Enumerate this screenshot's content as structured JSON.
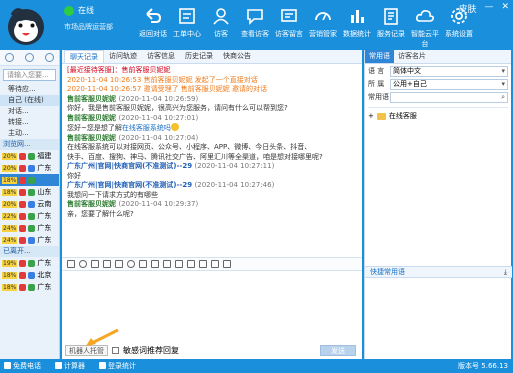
{
  "app": {
    "status": "在线",
    "org": "市场品牌运营部",
    "window_controls": [
      "皮肤",
      "—",
      "✕"
    ]
  },
  "toolbar": [
    {
      "label": "返回对话",
      "icon": "back-arrow-icon"
    },
    {
      "label": "工单中心",
      "icon": "ticket-icon"
    },
    {
      "label": "访客",
      "icon": "visitor-icon"
    },
    {
      "label": "查看访客",
      "icon": "chat-bubble-icon"
    },
    {
      "label": "访客留言",
      "icon": "message-board-icon"
    },
    {
      "label": "营销管家",
      "icon": "gauge-icon"
    },
    {
      "label": "数据统计",
      "icon": "bar-chart-icon"
    },
    {
      "label": "服务记录",
      "icon": "records-icon"
    },
    {
      "label": "智能云平台",
      "icon": "cloud-icon"
    },
    {
      "label": "系统设置",
      "icon": "gear-icon"
    }
  ],
  "left": {
    "search_placeholder": "请输入您要...",
    "groups": [
      {
        "label": "等待应...",
        "type": "row"
      },
      {
        "label": "自己 (在线)",
        "type": "sel"
      },
      {
        "label": "对话...",
        "type": "row"
      },
      {
        "label": "转接...",
        "type": "row"
      },
      {
        "label": "主动...",
        "type": "row"
      },
      {
        "label": "浏览网...",
        "type": "head"
      }
    ],
    "visitors": [
      {
        "pct": "20%",
        "name": "福建",
        "sel": false
      },
      {
        "pct": "20%",
        "name": "广东",
        "sel": false
      },
      {
        "pct": "18%",
        "name": "",
        "sel": true
      },
      {
        "pct": "18%",
        "name": "山东",
        "sel": false
      },
      {
        "pct": "20%",
        "name": "云南",
        "sel": false
      },
      {
        "pct": "22%",
        "name": "广东",
        "sel": false
      },
      {
        "pct": "24%",
        "name": "广东",
        "sel": false
      },
      {
        "pct": "24%",
        "name": "广东",
        "sel": false
      }
    ],
    "left_head": "已离开...",
    "visitors2": [
      {
        "pct": "19%",
        "name": "广东"
      },
      {
        "pct": "18%",
        "name": "北京"
      },
      {
        "pct": "18%",
        "name": "广东"
      }
    ]
  },
  "center": {
    "tabs": [
      "聊天记录",
      "访问轨迹",
      "访客信息",
      "历史记录",
      "快商公告"
    ],
    "chat": [
      {
        "cls": "c-red",
        "text": "[最近接待客服]：售前客服贝妮妮"
      },
      {
        "cls": "c-orange",
        "text": "2020-11-04 10:26:53 售前客服贝妮妮 发起了一个直接对话"
      },
      {
        "cls": "c-orange",
        "text": "2020-11-04 10:26:57 邀请受理了 售前客服贝妮妮 邀请的对话"
      },
      {
        "cls": "c-green",
        "text": "售前客服贝妮妮",
        "time": "(2020-11-04 10:26:59)"
      },
      {
        "cls": "c-text",
        "text": "你好，我是售前客服贝妮妮，很高兴为您服务，请问有什么可以帮到您?"
      },
      {
        "cls": "c-green",
        "text": "售前客服贝妮妮",
        "time": "(2020-11-04 10:27:01)"
      },
      {
        "cls": "c-text",
        "text": "您好~您是想了解",
        "hl": "在线客服系统吗",
        "smile": true
      },
      {
        "cls": "c-green",
        "text": "售前客服贝妮妮",
        "time": "(2020-11-04 10:27:04)"
      },
      {
        "cls": "c-text",
        "text": "在线客服系统可以对接网页、公众号、小程序、APP、微博、今日头条、抖音、"
      },
      {
        "cls": "c-text",
        "text": "快手、百度、搜狗、神马、腾讯社交广告、阿里汇川等全渠道，咱是想对接哪里呢?"
      },
      {
        "cls": "c-blue",
        "text": "广东广州|官网|快商官网(不准测试)--29",
        "time": "(2020-11-04 10:27:11)"
      },
      {
        "cls": "c-text",
        "text": "你好"
      },
      {
        "cls": "c-blue",
        "text": "广东广州|官网|快商官网(不准测试)--29",
        "time": "(2020-11-04 10:27:46)"
      },
      {
        "cls": "c-text",
        "text": "我想问一下请求方式的有哪些"
      },
      {
        "cls": "c-green",
        "text": "售前客服贝妮妮",
        "time": "(2020-11-04 10:29:37)"
      },
      {
        "cls": "c-text",
        "text": "亲，您要了解什么呢?"
      }
    ],
    "robot_btn": "机器人托管",
    "recommend": "敏感词推荐回复",
    "send": "发送"
  },
  "right": {
    "tabs": [
      "常用语",
      "访客名片"
    ],
    "rows": [
      {
        "label": "语 言",
        "value": "简体中文"
      },
      {
        "label": "所 属",
        "value": "公用+自己"
      },
      {
        "label": "常用语",
        "value": ""
      }
    ],
    "tree_item": "在线客服",
    "quick": "快捷常用语"
  },
  "footer": {
    "items": [
      "免费电话",
      "计算器",
      "登录统计"
    ],
    "version": "版本号 5.66.13"
  }
}
